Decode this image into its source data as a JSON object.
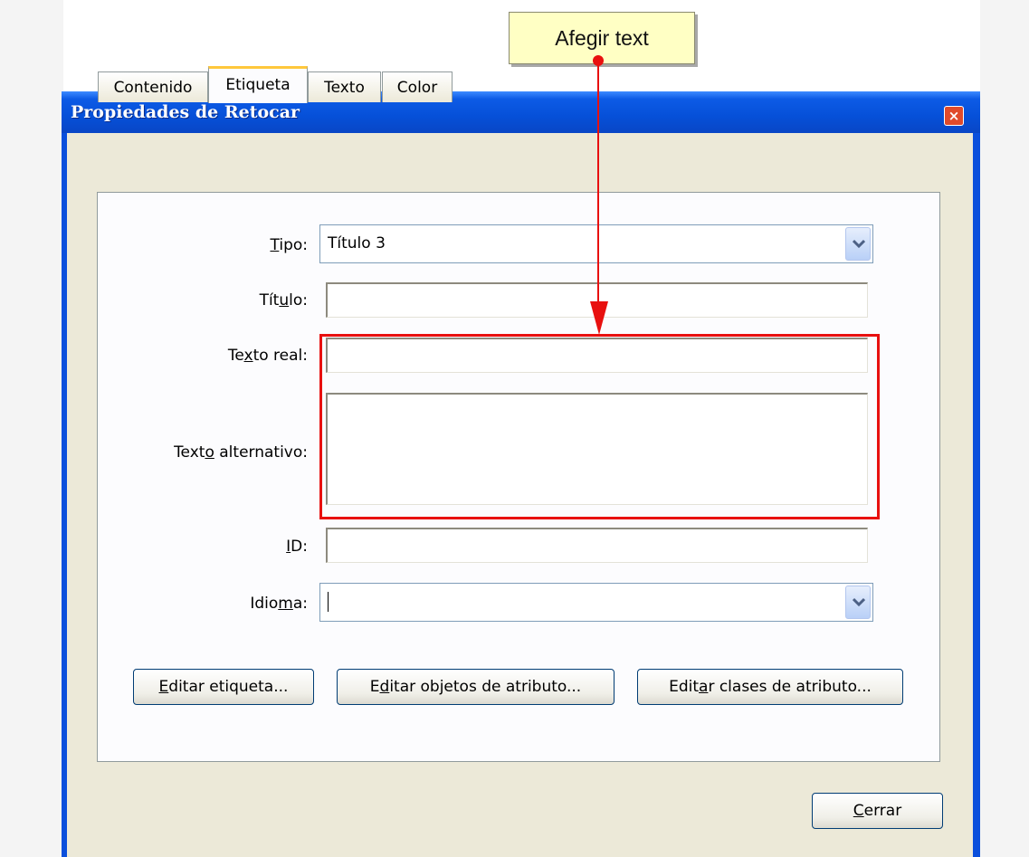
{
  "callout": {
    "text": "Afegir text"
  },
  "window": {
    "title": "Propiedades de Retocar",
    "close_glyph": "×"
  },
  "tabs": [
    {
      "label": "Contenido",
      "active": false
    },
    {
      "label": "Etiqueta",
      "active": true
    },
    {
      "label": "Texto",
      "active": false
    },
    {
      "label": "Color",
      "active": false
    }
  ],
  "form": {
    "tipo_label_pre": "",
    "tipo_label_u": "T",
    "tipo_label_post": "ipo:",
    "tipo_value": "Título 3",
    "titulo_label_pre": "Tít",
    "titulo_label_u": "u",
    "titulo_label_post": "lo:",
    "titulo_value": "",
    "texto_real_label_pre": "Te",
    "texto_real_label_u": "x",
    "texto_real_label_post": "to real:",
    "texto_real_value": "",
    "texto_alt_label_pre": "Text",
    "texto_alt_label_u": "o",
    "texto_alt_label_post": " alternativo:",
    "texto_alt_value": "",
    "id_label_pre": "",
    "id_label_u": "I",
    "id_label_post": "D:",
    "id_value": "",
    "idioma_label_pre": "Idio",
    "idioma_label_u": "m",
    "idioma_label_post": "a:",
    "idioma_value": ""
  },
  "buttons": {
    "editar_etiqueta_pre": "",
    "editar_etiqueta_u": "E",
    "editar_etiqueta_post": "ditar etiqueta...",
    "editar_objetos_pre": "E",
    "editar_objetos_u": "d",
    "editar_objetos_post": "itar objetos de atributo...",
    "editar_clases_pre": "Edit",
    "editar_clases_u": "a",
    "editar_clases_post": "r clases de atributo...",
    "cerrar_pre": "",
    "cerrar_u": "C",
    "cerrar_post": "errar"
  },
  "colors": {
    "titlebar": "#0a4fdc",
    "highlight": "#e8100f",
    "callout_bg": "#ffffc4",
    "tab_accent": "#ffc83c"
  },
  "icons": [
    "close-icon",
    "chevron-down-icon",
    "arrow-down-icon"
  ]
}
